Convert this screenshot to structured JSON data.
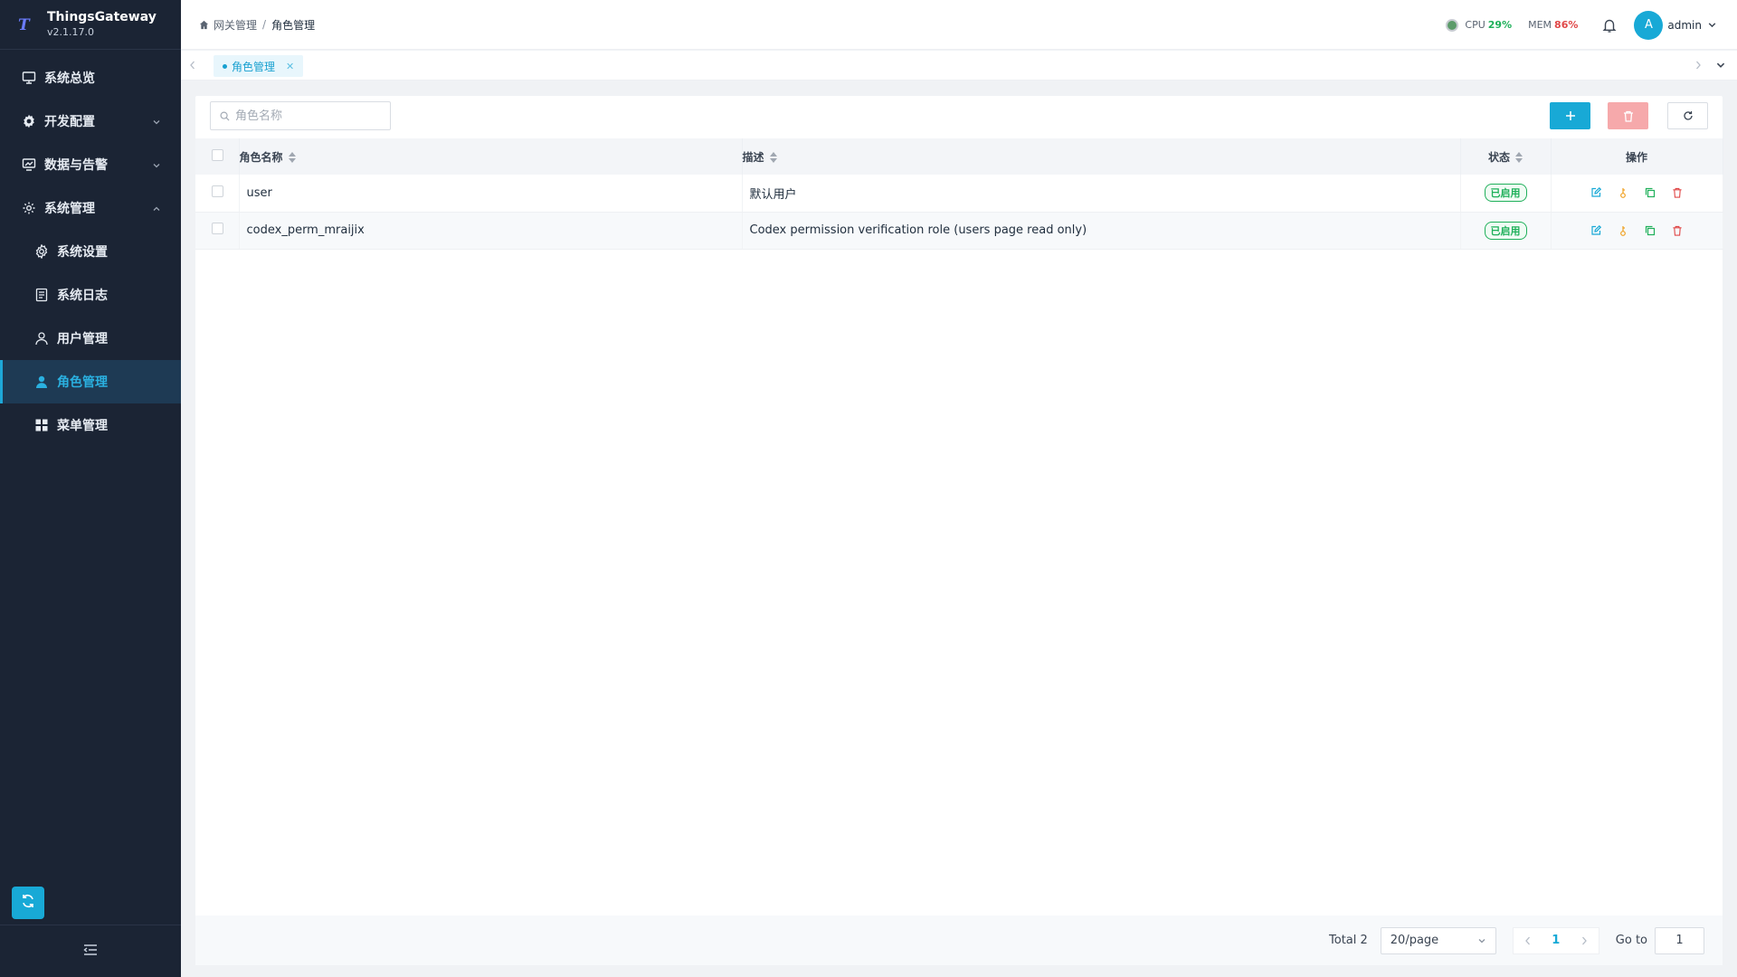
{
  "app": {
    "name": "ThingsGateway",
    "version": "v2.1.17.0",
    "logo_letter": "T"
  },
  "sidebar": {
    "items": [
      {
        "label": "系统总览",
        "icon": "monitor-icon"
      },
      {
        "label": "开发配置",
        "icon": "gear-icon",
        "expandable": true,
        "expanded": false
      },
      {
        "label": "数据与告警",
        "icon": "chart-monitor-icon",
        "expandable": true,
        "expanded": false
      },
      {
        "label": "系统管理",
        "icon": "settings-icon",
        "expandable": true,
        "expanded": true
      }
    ],
    "sub_items": [
      {
        "label": "系统设置",
        "icon": "gear-outline-icon"
      },
      {
        "label": "系统日志",
        "icon": "log-icon"
      },
      {
        "label": "用户管理",
        "icon": "user-outline-icon"
      },
      {
        "label": "角色管理",
        "icon": "user-solid-icon",
        "active": true
      },
      {
        "label": "菜单管理",
        "icon": "grid-icon"
      }
    ]
  },
  "header": {
    "breadcrumb": [
      "网关管理",
      "角色管理"
    ],
    "cpu_label": "CPU",
    "cpu_value": "29%",
    "mem_label": "MEM",
    "mem_value": "86%",
    "avatar_letter": "A",
    "username": "admin"
  },
  "tabs": [
    {
      "label": "角色管理",
      "active": true
    }
  ],
  "toolbar": {
    "search_placeholder": "角色名称"
  },
  "table": {
    "columns": [
      "角色名称",
      "描述",
      "状态",
      "操作"
    ],
    "rows": [
      {
        "name": "user",
        "description": "默认用户",
        "status": "已启用"
      },
      {
        "name": "codex_perm_mraijix",
        "description": "Codex permission verification role (users page read only)",
        "status": "已启用"
      }
    ]
  },
  "pagination": {
    "total_label": "Total 2",
    "page_size": "20/page",
    "current_page": "1",
    "goto_label": "Go to",
    "goto_value": "1"
  },
  "colors": {
    "accent": "#18a9d6",
    "sidebar_bg": "#1b2434",
    "success": "#1fb05a",
    "danger": "#e04848",
    "warning": "#f0a020"
  }
}
